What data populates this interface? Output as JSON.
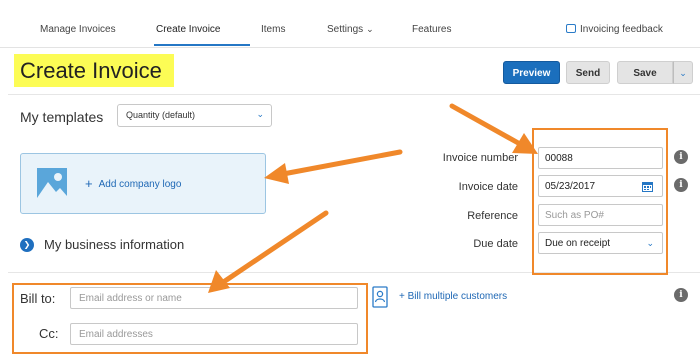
{
  "nav": {
    "tabs": [
      {
        "label": "Manage Invoices"
      },
      {
        "label": "Create Invoice",
        "active": true
      },
      {
        "label": "Items"
      },
      {
        "label": "Settings",
        "has_dropdown": true
      },
      {
        "label": "Features"
      }
    ],
    "feedback_label": "Invoicing feedback"
  },
  "page_title": "Create Invoice",
  "actions": {
    "preview": "Preview",
    "send": "Send",
    "save": "Save"
  },
  "templates": {
    "label": "My templates",
    "selected": "Quantity (default)"
  },
  "logo": {
    "add_label": "Add company logo"
  },
  "business": {
    "label": "My business information"
  },
  "invoice_fields": {
    "number": {
      "label": "Invoice number",
      "value": "00088"
    },
    "date": {
      "label": "Invoice date",
      "value": "05/23/2017"
    },
    "reference": {
      "label": "Reference",
      "placeholder": "Such as PO#"
    },
    "due": {
      "label": "Due date",
      "value": "Due on receipt"
    }
  },
  "billing": {
    "bill_to_label": "Bill to:",
    "bill_to_placeholder": "Email address or name",
    "cc_label": "Cc:",
    "cc_placeholder": "Email addresses",
    "multiple_label": "Bill multiple customers"
  },
  "colors": {
    "accent": "#1b6fbd",
    "highlight": "#fcfc55",
    "annotation": "#f0882a"
  }
}
